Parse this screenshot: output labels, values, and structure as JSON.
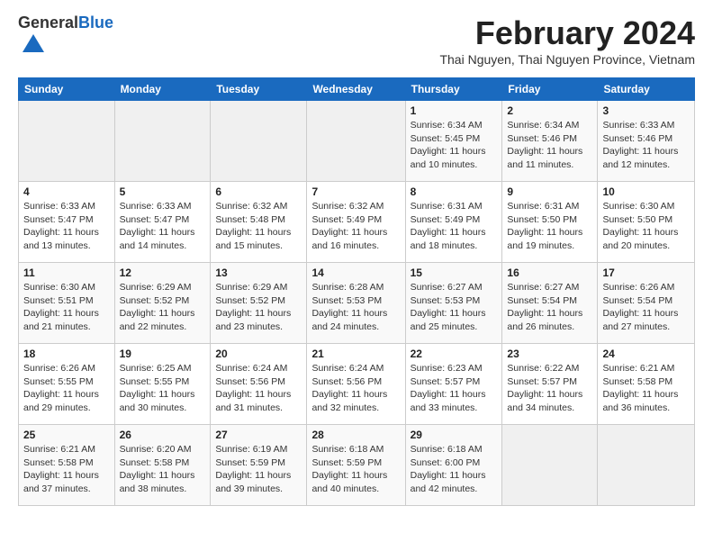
{
  "header": {
    "logo_general": "General",
    "logo_blue": "Blue",
    "month_title": "February 2024",
    "subtitle": "Thai Nguyen, Thai Nguyen Province, Vietnam"
  },
  "weekdays": [
    "Sunday",
    "Monday",
    "Tuesday",
    "Wednesday",
    "Thursday",
    "Friday",
    "Saturday"
  ],
  "weeks": [
    [
      {
        "day": "",
        "info": ""
      },
      {
        "day": "",
        "info": ""
      },
      {
        "day": "",
        "info": ""
      },
      {
        "day": "",
        "info": ""
      },
      {
        "day": "1",
        "info": "Sunrise: 6:34 AM\nSunset: 5:45 PM\nDaylight: 11 hours\nand 10 minutes."
      },
      {
        "day": "2",
        "info": "Sunrise: 6:34 AM\nSunset: 5:46 PM\nDaylight: 11 hours\nand 11 minutes."
      },
      {
        "day": "3",
        "info": "Sunrise: 6:33 AM\nSunset: 5:46 PM\nDaylight: 11 hours\nand 12 minutes."
      }
    ],
    [
      {
        "day": "4",
        "info": "Sunrise: 6:33 AM\nSunset: 5:47 PM\nDaylight: 11 hours\nand 13 minutes."
      },
      {
        "day": "5",
        "info": "Sunrise: 6:33 AM\nSunset: 5:47 PM\nDaylight: 11 hours\nand 14 minutes."
      },
      {
        "day": "6",
        "info": "Sunrise: 6:32 AM\nSunset: 5:48 PM\nDaylight: 11 hours\nand 15 minutes."
      },
      {
        "day": "7",
        "info": "Sunrise: 6:32 AM\nSunset: 5:49 PM\nDaylight: 11 hours\nand 16 minutes."
      },
      {
        "day": "8",
        "info": "Sunrise: 6:31 AM\nSunset: 5:49 PM\nDaylight: 11 hours\nand 18 minutes."
      },
      {
        "day": "9",
        "info": "Sunrise: 6:31 AM\nSunset: 5:50 PM\nDaylight: 11 hours\nand 19 minutes."
      },
      {
        "day": "10",
        "info": "Sunrise: 6:30 AM\nSunset: 5:50 PM\nDaylight: 11 hours\nand 20 minutes."
      }
    ],
    [
      {
        "day": "11",
        "info": "Sunrise: 6:30 AM\nSunset: 5:51 PM\nDaylight: 11 hours\nand 21 minutes."
      },
      {
        "day": "12",
        "info": "Sunrise: 6:29 AM\nSunset: 5:52 PM\nDaylight: 11 hours\nand 22 minutes."
      },
      {
        "day": "13",
        "info": "Sunrise: 6:29 AM\nSunset: 5:52 PM\nDaylight: 11 hours\nand 23 minutes."
      },
      {
        "day": "14",
        "info": "Sunrise: 6:28 AM\nSunset: 5:53 PM\nDaylight: 11 hours\nand 24 minutes."
      },
      {
        "day": "15",
        "info": "Sunrise: 6:27 AM\nSunset: 5:53 PM\nDaylight: 11 hours\nand 25 minutes."
      },
      {
        "day": "16",
        "info": "Sunrise: 6:27 AM\nSunset: 5:54 PM\nDaylight: 11 hours\nand 26 minutes."
      },
      {
        "day": "17",
        "info": "Sunrise: 6:26 AM\nSunset: 5:54 PM\nDaylight: 11 hours\nand 27 minutes."
      }
    ],
    [
      {
        "day": "18",
        "info": "Sunrise: 6:26 AM\nSunset: 5:55 PM\nDaylight: 11 hours\nand 29 minutes."
      },
      {
        "day": "19",
        "info": "Sunrise: 6:25 AM\nSunset: 5:55 PM\nDaylight: 11 hours\nand 30 minutes."
      },
      {
        "day": "20",
        "info": "Sunrise: 6:24 AM\nSunset: 5:56 PM\nDaylight: 11 hours\nand 31 minutes."
      },
      {
        "day": "21",
        "info": "Sunrise: 6:24 AM\nSunset: 5:56 PM\nDaylight: 11 hours\nand 32 minutes."
      },
      {
        "day": "22",
        "info": "Sunrise: 6:23 AM\nSunset: 5:57 PM\nDaylight: 11 hours\nand 33 minutes."
      },
      {
        "day": "23",
        "info": "Sunrise: 6:22 AM\nSunset: 5:57 PM\nDaylight: 11 hours\nand 34 minutes."
      },
      {
        "day": "24",
        "info": "Sunrise: 6:21 AM\nSunset: 5:58 PM\nDaylight: 11 hours\nand 36 minutes."
      }
    ],
    [
      {
        "day": "25",
        "info": "Sunrise: 6:21 AM\nSunset: 5:58 PM\nDaylight: 11 hours\nand 37 minutes."
      },
      {
        "day": "26",
        "info": "Sunrise: 6:20 AM\nSunset: 5:58 PM\nDaylight: 11 hours\nand 38 minutes."
      },
      {
        "day": "27",
        "info": "Sunrise: 6:19 AM\nSunset: 5:59 PM\nDaylight: 11 hours\nand 39 minutes."
      },
      {
        "day": "28",
        "info": "Sunrise: 6:18 AM\nSunset: 5:59 PM\nDaylight: 11 hours\nand 40 minutes."
      },
      {
        "day": "29",
        "info": "Sunrise: 6:18 AM\nSunset: 6:00 PM\nDaylight: 11 hours\nand 42 minutes."
      },
      {
        "day": "",
        "info": ""
      },
      {
        "day": "",
        "info": ""
      }
    ]
  ]
}
